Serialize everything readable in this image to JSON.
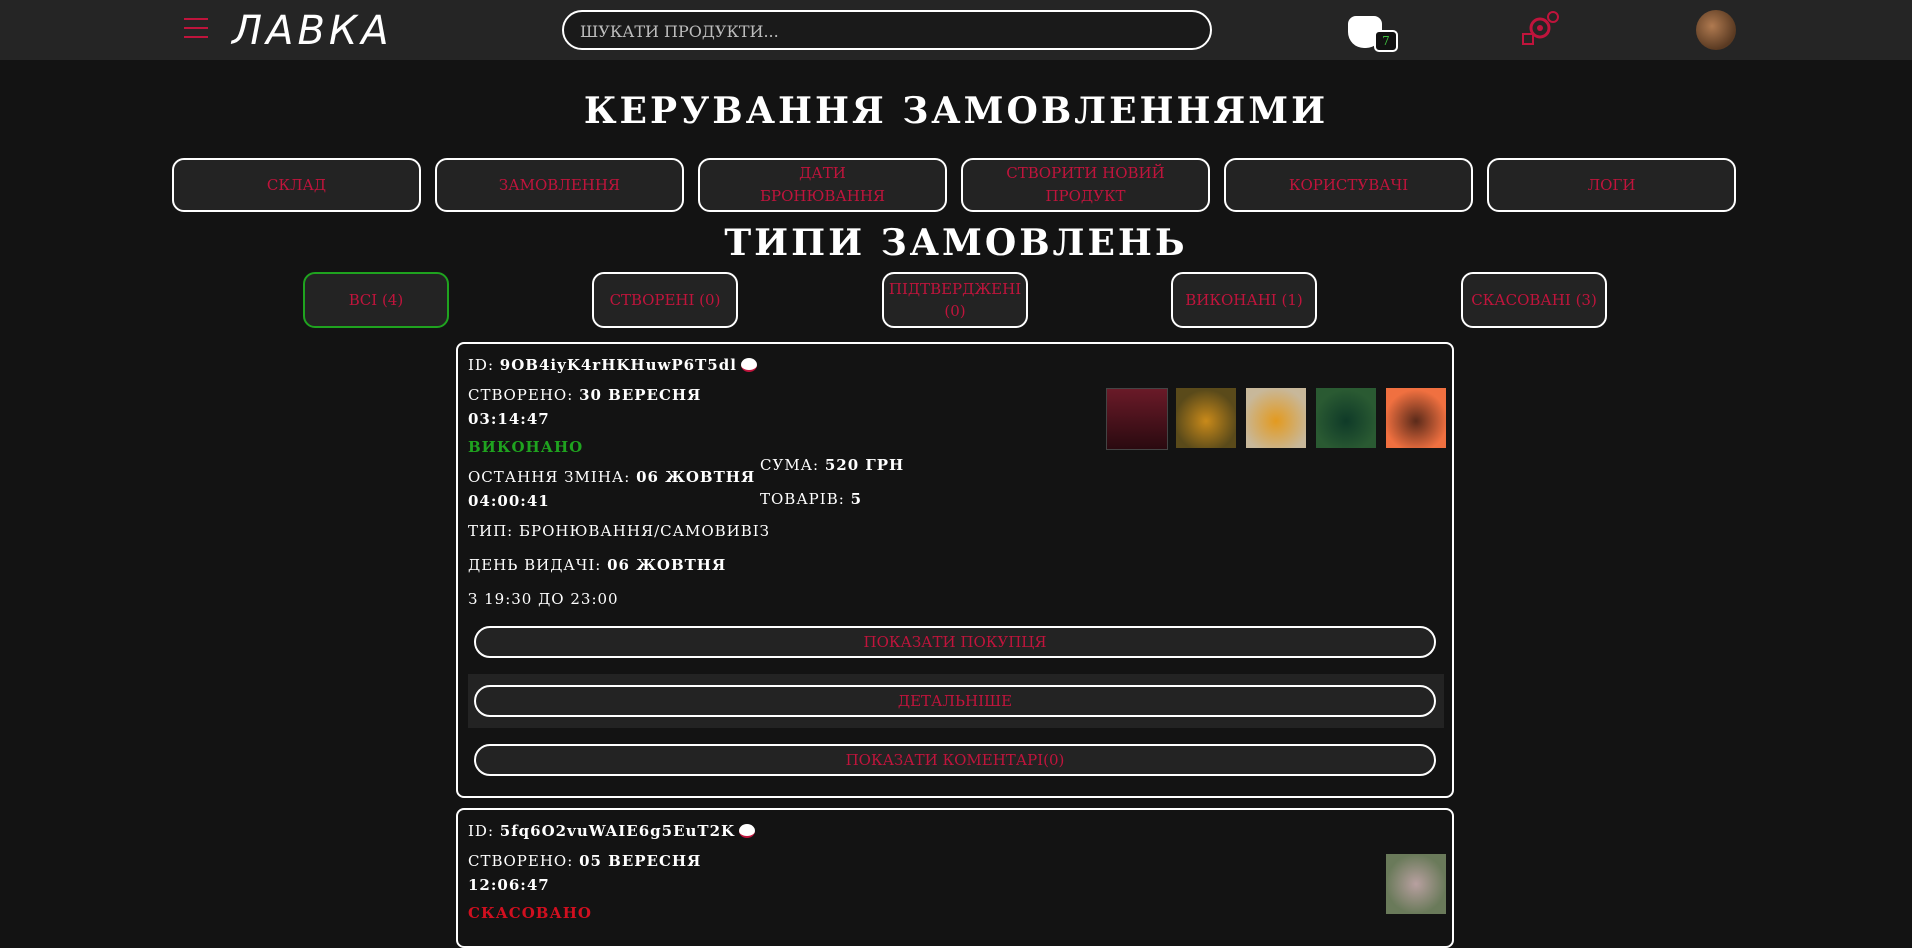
{
  "header": {
    "logo": "ЛАВКА",
    "search_placeholder": "ШУКАТИ ПРОДУКТИ...",
    "cart_count": "7"
  },
  "page_title": "КЕРУВАННЯ ЗАМОВЛЕННЯМИ",
  "nav": [
    {
      "label": "СКЛАД"
    },
    {
      "label": "ЗАМОВЛЕННЯ"
    },
    {
      "label": "ДАТИ БРОНЮВАННЯ"
    },
    {
      "label": "СТВОРИТИ НОВИЙ ПРОДУКТ"
    },
    {
      "label": "КОРИСТУВАЧІ"
    },
    {
      "label": "ЛОГИ"
    }
  ],
  "types_title": "ТИПИ ЗАМОВЛЕНЬ",
  "types": [
    {
      "label": "ВСІ (4)",
      "active": true
    },
    {
      "label": "СТВОРЕНІ (0)"
    },
    {
      "label": "ПІДТВЕРДЖЕНІ (0)"
    },
    {
      "label": "ВИКОНАНІ (1)"
    },
    {
      "label": "СКАСОВАНІ (3)"
    }
  ],
  "orders": [
    {
      "id_label": "ID:",
      "id": "9OB4iyK4rHKHuwP6T5dl",
      "created_label": "СТВОРЕНО:",
      "created_date": "30 ВЕРЕСНЯ",
      "created_time": "03:14:47",
      "status": "ВИКОНАНО",
      "changed_label": "ОСТАННЯ ЗМІНА:",
      "changed_date": "06 ЖОВТНЯ",
      "changed_time": "04:00:41",
      "type_label": "ТИП:",
      "type": "БРОНЮВАННЯ/САМОВИВІЗ",
      "pickup_label": "ДЕНЬ ВИДАЧІ:",
      "pickup_date": "06 ЖОВТНЯ",
      "pickup_time": "З 19:30 ДО 23:00",
      "sum_label": "СУМА:",
      "sum": "520 ГРН",
      "items_label": "ТОВАРІВ:",
      "items": "5",
      "buttons": {
        "buyer": "ПОКАЗАТИ ПОКУПЦЯ",
        "details": "ДЕТАЛЬНІШЕ",
        "comments": "ПОКАЗАТИ КОМЕНТАРІ(0)"
      }
    },
    {
      "id_label": "ID:",
      "id": "5fq6O2vuWAIE6g5EuT2K",
      "created_label": "СТВОРЕНО:",
      "created_date": "05 ВЕРЕСНЯ",
      "created_time": "12:06:47",
      "status": "СКАСОВАНО"
    }
  ],
  "colors": {
    "accent": "#c0143c",
    "success": "#1fa31f",
    "danger": "#d10f1f",
    "bg": "#131313",
    "panel": "#232323"
  }
}
